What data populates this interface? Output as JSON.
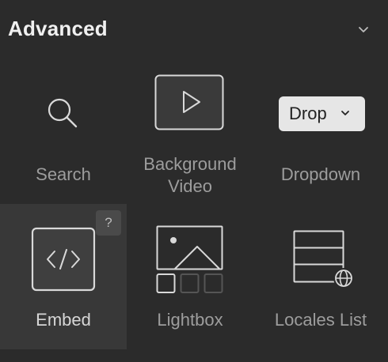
{
  "section": {
    "title": "Advanced",
    "toggle_icon": "chevron-down-icon"
  },
  "elements": [
    {
      "label": "Search",
      "icon": "search-icon"
    },
    {
      "label_line1": "Background",
      "label_line2": "Video",
      "icon": "play-icon"
    },
    {
      "label": "Dropdown",
      "icon": "dropdown-preview",
      "preview_text": "Drop"
    },
    {
      "label": "Embed",
      "icon": "code-icon",
      "selected": true
    },
    {
      "label": "Lightbox",
      "icon": "lightbox-icon"
    },
    {
      "label": "Locales List",
      "icon": "locales-list-icon"
    }
  ],
  "help_badge": "?",
  "colors": {
    "panel_bg": "#2b2b2b",
    "selected_bg": "#383838",
    "icon_stroke": "#d9d9d9",
    "label_text": "#9d9d9d",
    "title_text": "#f0f0f0"
  }
}
